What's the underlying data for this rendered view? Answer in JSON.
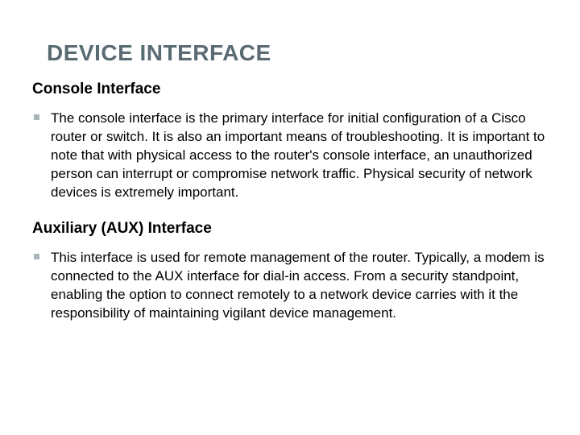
{
  "title": "DEVICE INTERFACE",
  "sections": [
    {
      "heading": "Console Interface",
      "bullet": "The console interface is the primary interface for initial configuration of a Cisco router or switch. It is also an important means of troubleshooting. It is important to note that with physical access to the router's console interface, an unauthorized person can interrupt or compromise network traffic. Physical security of network devices is extremely important."
    },
    {
      "heading": "Auxiliary (AUX) Interface",
      "bullet": "This interface is used for remote management of the router. Typically, a modem is connected to the AUX interface for dial-in access. From a security standpoint, enabling the option to connect remotely to a network device carries with it the responsibility of maintaining vigilant device management."
    }
  ]
}
